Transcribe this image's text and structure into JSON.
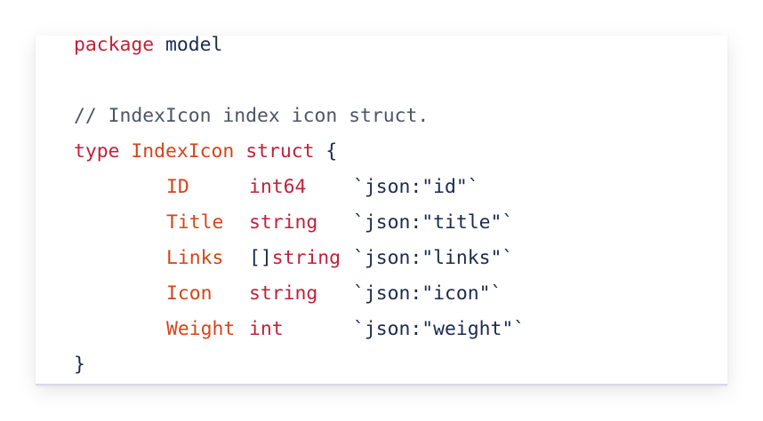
{
  "gutter": [
    "",
    "",
    "",
    "",
    "",
    "",
    "",
    "",
    "",
    ""
  ],
  "code": {
    "package_kw": "package",
    "package_name": "model",
    "comment": "// IndexIcon index icon struct.",
    "type_kw": "type",
    "type_name": "IndexIcon",
    "struct_kw": "struct",
    "open_brace": "{",
    "close_brace": "}",
    "fields": [
      {
        "name": "ID",
        "type_bracket": "",
        "type": "int64",
        "tag": "`json:\"id\"`"
      },
      {
        "name": "Title",
        "type_bracket": "",
        "type": "string",
        "tag": "`json:\"title\"`"
      },
      {
        "name": "Links",
        "type_bracket": "[]",
        "type": "string",
        "tag": "`json:\"links\"`"
      },
      {
        "name": "Icon",
        "type_bracket": "",
        "type": "string",
        "tag": "`json:\"icon\"`"
      },
      {
        "name": "Weight",
        "type_bracket": "",
        "type": "int",
        "tag": "`json:\"weight\"`"
      }
    ]
  },
  "colors": {
    "keyword": "#c0213a",
    "type_name": "#d4451b",
    "comment": "#4c5567",
    "text": "#1b2a4e"
  }
}
